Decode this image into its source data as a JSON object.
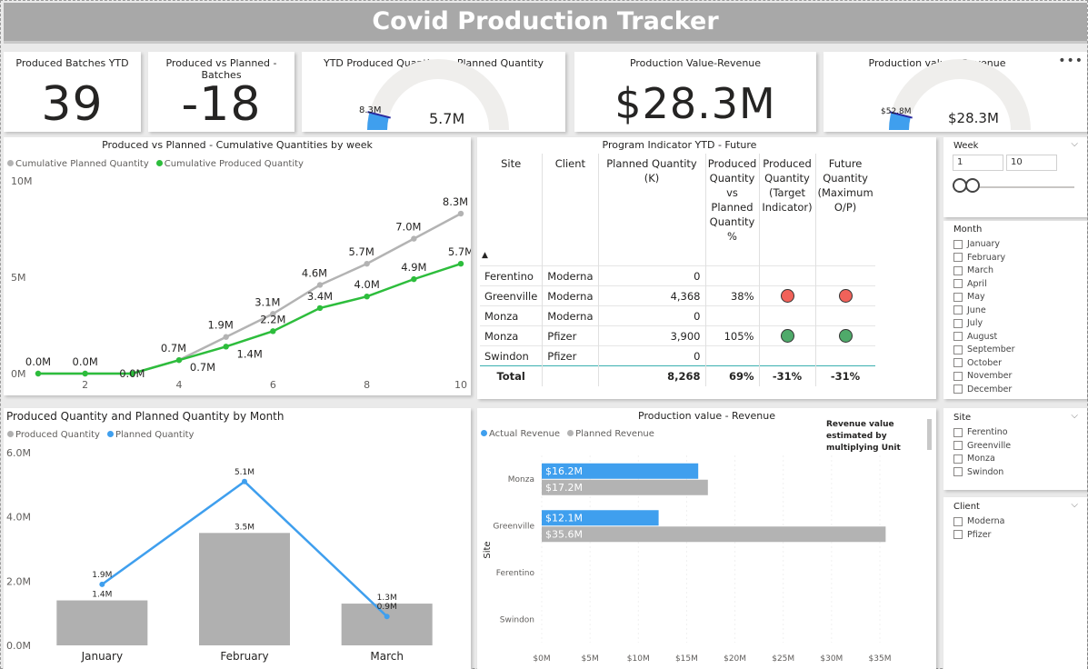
{
  "title": "Covid Production Tracker",
  "kpis": {
    "batches": {
      "title": "Produced Batches YTD",
      "value": "39"
    },
    "vs_planned": {
      "title": "Produced vs Planned - Batches",
      "value": "-18"
    },
    "value_revenue": {
      "title": "Production Value-Revenue",
      "value": "$28.3M"
    }
  },
  "gauges": {
    "qty": {
      "title": "YTD Produced Quantity vs Planned Quantity",
      "value": "5.7M",
      "target": "8.3M",
      "fraction": 0.69
    },
    "revenue": {
      "title": "Production value - Revenue",
      "value": "$28.3M",
      "target": "$52.8M",
      "fraction": 0.54
    }
  },
  "more_icon": "ellipsis-icon",
  "cumulative": {
    "title": "Produced vs Planned - Cumulative Quantities by week",
    "legend": [
      "Cumulative Planned Quantity",
      "Cumulative Produced Quantity"
    ],
    "colors": {
      "planned": "#b3b3b3",
      "produced": "#2dbd3c"
    },
    "y_ticks": [
      "10M",
      "5M",
      "0M"
    ],
    "x_ticks": [
      "2",
      "4",
      "6",
      "8",
      "10"
    ]
  },
  "monthly": {
    "title": "Produced Quantity and Planned Quantity by Month",
    "legend": [
      "Produced Quantity",
      "Planned Quantity"
    ],
    "colors": {
      "produced": "#b0b0b0",
      "planned": "#3f9fee"
    },
    "y_ticks": [
      "6.0M",
      "4.0M",
      "2.0M",
      "0.0M"
    ]
  },
  "program": {
    "title": "Program Indicator YTD - Future",
    "headers": [
      "Site",
      "Client",
      "Planned Quantity (K)",
      "Produced Quantity vs Planned Quantity %",
      "Produced Quantity (Target Indicator)",
      "Future Quantity (Maximum O/P)"
    ],
    "rows": [
      {
        "site": "Ferentino",
        "client": "Moderna",
        "planned": "0",
        "pct": "",
        "target": "",
        "future": ""
      },
      {
        "site": "Greenville",
        "client": "Moderna",
        "planned": "4,368",
        "pct": "38%",
        "target": "red",
        "future": "red"
      },
      {
        "site": "Monza",
        "client": "Moderna",
        "planned": "0",
        "pct": "",
        "target": "",
        "future": ""
      },
      {
        "site": "Monza",
        "client": "Pfizer",
        "planned": "3,900",
        "pct": "105%",
        "target": "green",
        "future": "green"
      },
      {
        "site": "Swindon",
        "client": "Pfizer",
        "planned": "0",
        "pct": "",
        "target": "",
        "future": ""
      }
    ],
    "total": {
      "label": "Total",
      "planned": "8,268",
      "pct": "69%",
      "target": "-31%",
      "future": "-31%"
    },
    "indicator_colors": {
      "red": "#f1625a",
      "green": "#4faa6a"
    },
    "sort_icon": "sort-up-icon"
  },
  "revenue_bars": {
    "title": "Production value - Revenue",
    "legend": [
      "Actual Revenue",
      "Planned Revenue"
    ],
    "colors": {
      "actual": "#3f9fee",
      "planned": "#b3b3b3"
    },
    "note": "Revenue value estimated by multiplying Unit Price X Unit Produced",
    "y_axis_label": "Site",
    "x_ticks": [
      "$0M",
      "$5M",
      "$10M",
      "$15M",
      "$20M",
      "$25M",
      "$30M",
      "$35M"
    ]
  },
  "slicers": {
    "week": {
      "title": "Week",
      "from": "1",
      "to": "10"
    },
    "month": {
      "title": "Month",
      "items": [
        "January",
        "February",
        "March",
        "April",
        "May",
        "June",
        "July",
        "August",
        "September",
        "October",
        "November",
        "December"
      ]
    },
    "site": {
      "title": "Site",
      "items": [
        "Ferentino",
        "Greenville",
        "Monza",
        "Swindon"
      ]
    },
    "client": {
      "title": "Client",
      "items": [
        "Moderna",
        "Pfizer"
      ]
    }
  },
  "chart_data": [
    {
      "type": "line",
      "title": "Produced vs Planned - Cumulative Quantities by week",
      "x": [
        1,
        2,
        3,
        4,
        5,
        6,
        7,
        8,
        9,
        10
      ],
      "series": [
        {
          "name": "Cumulative Planned Quantity",
          "values": [
            0.0,
            0.0,
            0.0,
            0.7,
            1.9,
            3.1,
            4.6,
            5.7,
            7.0,
            8.3
          ],
          "labels": [
            "",
            "",
            "",
            "0.7M",
            "1.9M",
            "3.1M",
            "4.6M",
            "5.7M",
            "7.0M",
            "8.3M"
          ]
        },
        {
          "name": "Cumulative Produced Quantity",
          "values": [
            0.0,
            0.0,
            0.0,
            0.7,
            1.4,
            2.2,
            3.4,
            4.0,
            4.9,
            5.7
          ],
          "labels": [
            "0.0M",
            "0.0M",
            "0.0M",
            "0.7M",
            "1.4M",
            "2.2M",
            "3.4M",
            "4.0M",
            "4.9M",
            "5.7M"
          ]
        }
      ],
      "ylim": [
        0,
        10
      ],
      "x_ticks": [
        2,
        4,
        6,
        8,
        10
      ],
      "legend": "top-left"
    },
    {
      "type": "bar",
      "title": "Produced Quantity and Planned Quantity by Month",
      "categories": [
        "January",
        "February",
        "March"
      ],
      "series": [
        {
          "name": "Produced Quantity",
          "values": [
            1.4,
            3.5,
            1.3
          ],
          "labels": [
            "1.4M",
            "3.5M",
            "1.3M"
          ],
          "kind": "bar"
        },
        {
          "name": "Planned Quantity",
          "values": [
            1.9,
            5.1,
            0.9
          ],
          "labels": [
            "1.9M",
            "5.1M",
            "0.9M"
          ],
          "kind": "line"
        }
      ],
      "ylim": [
        0,
        6
      ],
      "legend": "top-left"
    },
    {
      "type": "bar",
      "orientation": "horizontal",
      "title": "Production value - Revenue",
      "categories": [
        "Monza",
        "Greenville",
        "Ferentino",
        "Swindon"
      ],
      "series": [
        {
          "name": "Actual Revenue",
          "values": [
            16.2,
            12.1,
            0,
            0
          ],
          "labels": [
            "$16.2M",
            "$12.1M",
            "",
            ""
          ]
        },
        {
          "name": "Planned Revenue",
          "values": [
            17.2,
            35.6,
            0,
            0
          ],
          "labels": [
            "$17.2M",
            "$35.6M",
            "",
            ""
          ]
        }
      ],
      "xlim": [
        0,
        35
      ],
      "legend": "top-left"
    }
  ]
}
